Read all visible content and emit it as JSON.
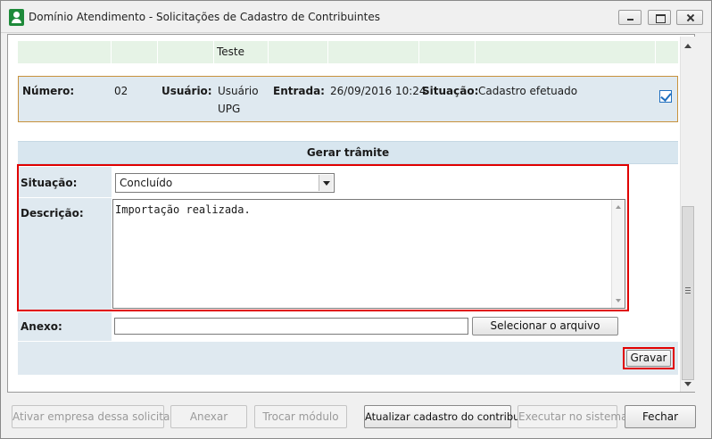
{
  "window": {
    "title": "Domínio Atendimento - Solicitações de Cadastro de Contribuintes"
  },
  "prev_row": {
    "text": "Teste"
  },
  "record": {
    "numero_label": "Número:",
    "numero_value": "02",
    "usuario_label": "Usuário:",
    "usuario_value_line1": "Usuário",
    "usuario_value_line2": "UPG",
    "entrada_label": "Entrada:",
    "entrada_value": "26/09/2016 10:24",
    "situacao_label": "Situação:",
    "situacao_value": "Cadastro efetuado",
    "checked": true
  },
  "form": {
    "section_title": "Gerar trâmite",
    "situacao_label": "Situação:",
    "situacao_selected": "Concluído",
    "descricao_label": "Descrição:",
    "descricao_value": "Importação realizada.",
    "anexo_label": "Anexo:",
    "anexo_value": "",
    "select_file_label": "Selecionar o arquivo",
    "save_label": "Gravar"
  },
  "footer": {
    "buttons": [
      {
        "label": "Ativar empresa dessa solicitação",
        "enabled": false
      },
      {
        "label": "Anexar",
        "enabled": false
      },
      {
        "label": "Trocar módulo",
        "enabled": false
      },
      {
        "label": "Atualizar cadastro do contribuinte",
        "enabled": true
      },
      {
        "label": "Executar no sistema",
        "enabled": false
      },
      {
        "label": "Fechar",
        "enabled": true
      }
    ]
  },
  "colors": {
    "highlight_border": "#e00000",
    "row_border": "#c8923c",
    "label_bg": "#dfe9f0",
    "prev_row_bg": "#e6f3e6"
  }
}
